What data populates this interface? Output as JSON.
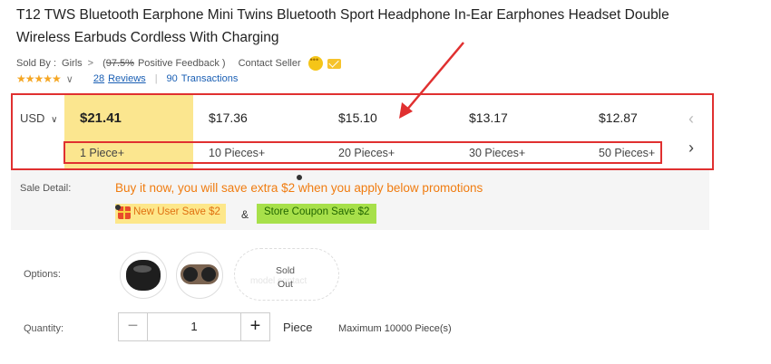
{
  "product": {
    "title": "T12 TWS Bluetooth Earphone Mini Twins Bluetooth Sport Headphone In-Ear Earphones Headset Double Wireless Earbuds Cordless With Charging"
  },
  "seller": {
    "sold_by_label": "Sold By :",
    "seller_name": "Girls",
    "chevron": ">",
    "feedback_open": "(",
    "feedback_percent": "97.5%",
    "feedback_suffix": "Positive Feedback )",
    "contact_label": "Contact Seller"
  },
  "rating": {
    "stars": "★★★★★",
    "chevron": "∨",
    "reviews_count": "28",
    "reviews_label": "Reviews",
    "separator": "|",
    "transactions_count": "90",
    "transactions_label": "Transactions"
  },
  "pricing": {
    "currency": "USD",
    "currency_chevron": "∨",
    "tiers": [
      {
        "price": "$21.41",
        "quantity": "1 Piece+"
      },
      {
        "price": "$17.36",
        "quantity": "10 Pieces+"
      },
      {
        "price": "$15.10",
        "quantity": "20 Pieces+"
      },
      {
        "price": "$13.17",
        "quantity": "30 Pieces+"
      },
      {
        "price": "$12.87",
        "quantity": "50 Pieces+"
      }
    ],
    "prev_icon": "‹",
    "next_icon": "›"
  },
  "sale": {
    "label": "Sale Detail:",
    "promo_text": "Buy it now, you will save extra $2 when you apply below promotions",
    "coupon_new_user": "New User Save $2",
    "amp": "&",
    "coupon_store": "Store Coupon Save $2"
  },
  "options": {
    "label": "Options:",
    "sold_out_line1": "Sold",
    "sold_out_line2": "Out",
    "ghost_text": "model  contact"
  },
  "quantity": {
    "label": "Quantity:",
    "minus": "−",
    "value": "1",
    "plus": "+",
    "unit": "Piece",
    "max_text": "Maximum 10000 Piece(s)"
  },
  "colors": {
    "annotation_red": "#e03030",
    "highlight_yellow": "#fbe68f",
    "promo_orange": "#f07c10",
    "link_blue": "#1a5fb4"
  }
}
